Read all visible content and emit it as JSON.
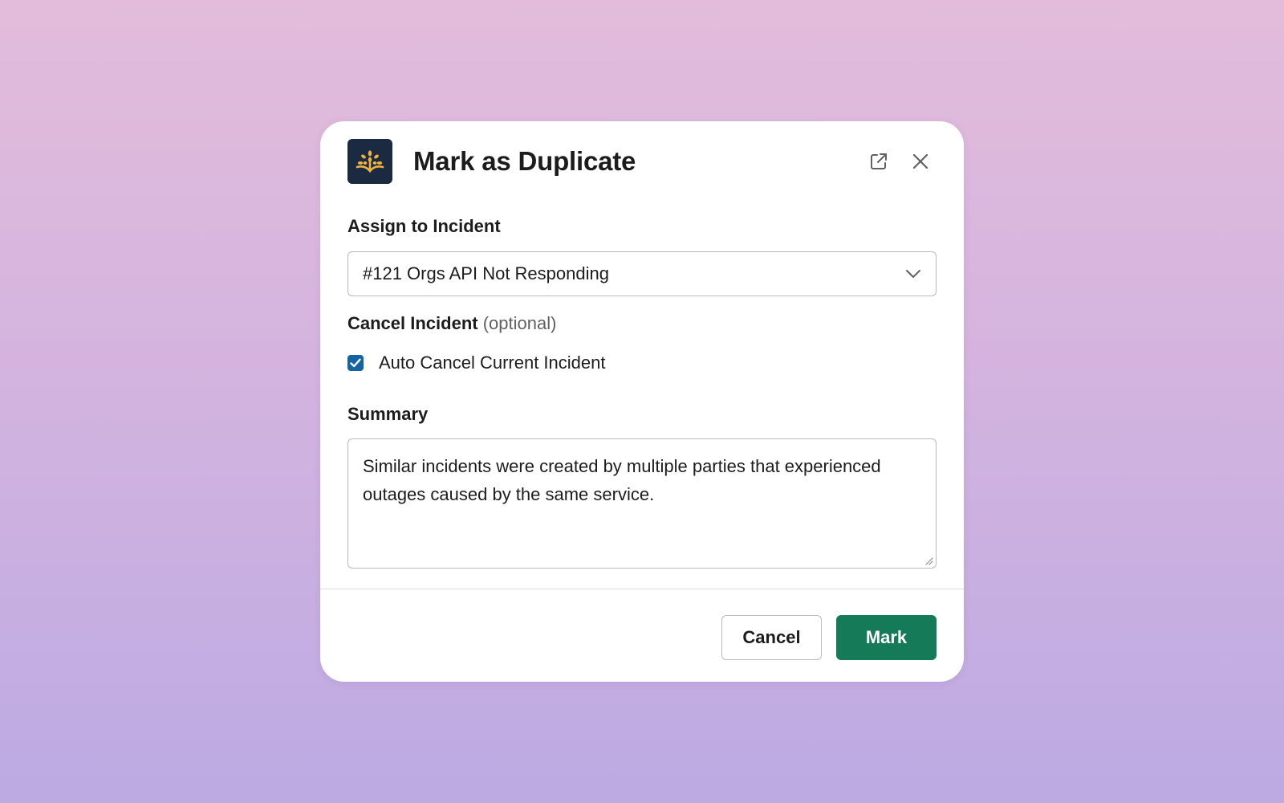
{
  "modal": {
    "title": "Mark as Duplicate",
    "logo_icon": "sprouting-sun-logo-icon",
    "header_icons": [
      "external-link-icon",
      "close-icon"
    ],
    "colors": {
      "logo_bg": "#1c2a41",
      "logo_accent": "#f0b33c",
      "checkbox": "#1264a3",
      "primary_button": "#147a57"
    }
  },
  "assign": {
    "label": "Assign to Incident",
    "selected": "#121 Orgs API Not Responding"
  },
  "cancel_incident": {
    "label": "Cancel Incident",
    "optional": "(optional)",
    "checkbox_label": "Auto Cancel Current Incident",
    "checked": true
  },
  "summary": {
    "label": "Summary",
    "value": "Similar incidents were created by multiple parties that experienced outages caused by the same service."
  },
  "footer": {
    "cancel_label": "Cancel",
    "mark_label": "Mark"
  }
}
